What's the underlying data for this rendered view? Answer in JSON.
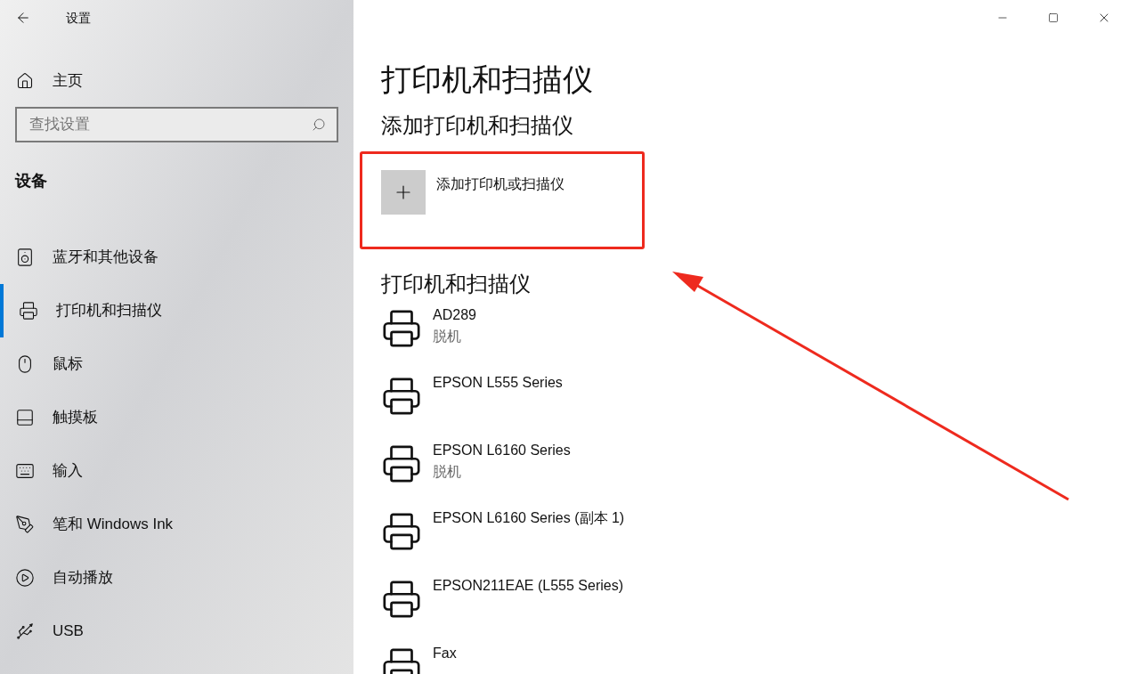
{
  "window": {
    "title": "设置"
  },
  "sidebar": {
    "home": "主页",
    "search": {
      "placeholder": "查找设置"
    },
    "section": "设备",
    "items": [
      {
        "kind": "bluetooth",
        "label": "蓝牙和其他设备",
        "selected": false
      },
      {
        "kind": "printer",
        "label": "打印机和扫描仪",
        "selected": true
      },
      {
        "kind": "mouse",
        "label": "鼠标",
        "selected": false
      },
      {
        "kind": "touchpad",
        "label": "触摸板",
        "selected": false
      },
      {
        "kind": "typing",
        "label": "输入",
        "selected": false
      },
      {
        "kind": "pen",
        "label": "笔和 Windows Ink",
        "selected": false
      },
      {
        "kind": "autoplay",
        "label": "自动播放",
        "selected": false
      },
      {
        "kind": "usb",
        "label": "USB",
        "selected": false
      }
    ]
  },
  "main": {
    "title": "打印机和扫描仪",
    "add_section": "添加打印机和扫描仪",
    "add_button": "添加打印机或扫描仪",
    "list_title": "打印机和扫描仪",
    "printers": [
      {
        "name": "AD289",
        "status": "脱机"
      },
      {
        "name": "EPSON L555 Series"
      },
      {
        "name": "EPSON L6160 Series",
        "status": "脱机"
      },
      {
        "name": "EPSON L6160 Series (副本 1)"
      },
      {
        "name": "EPSON211EAE (L555 Series)"
      },
      {
        "name": "Fax"
      }
    ]
  }
}
